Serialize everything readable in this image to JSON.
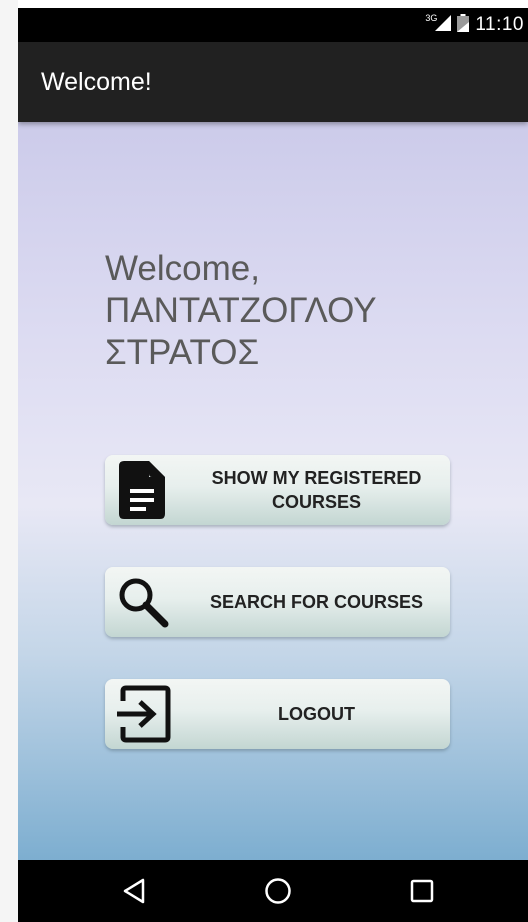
{
  "status_bar": {
    "network_type": "3G",
    "time": "11:10",
    "icons": [
      "signal-icon",
      "battery-icon"
    ]
  },
  "app_bar": {
    "title": "Welcome!"
  },
  "greeting": {
    "line1": "Welcome,",
    "line2": "ΠΑΝΤΑΤΖΟΓΛΟΥ",
    "line3": "ΣΤΡΑΤΟΣ"
  },
  "buttons": [
    {
      "label": "SHOW MY REGISTERED COURSES",
      "icon": "document-icon"
    },
    {
      "label": "SEARCH FOR COURSES",
      "icon": "search-icon"
    },
    {
      "label": "LOGOUT",
      "icon": "exit-icon"
    }
  ],
  "nav_bar": {
    "icons": [
      "back-icon",
      "home-icon",
      "recents-icon"
    ]
  },
  "colors": {
    "status_bar": "#000000",
    "app_bar": "#212121",
    "gradient_top": "#cccbea",
    "gradient_bottom": "#7daed0",
    "button_text": "#222222",
    "greeting_text": "#5a5a5a"
  }
}
